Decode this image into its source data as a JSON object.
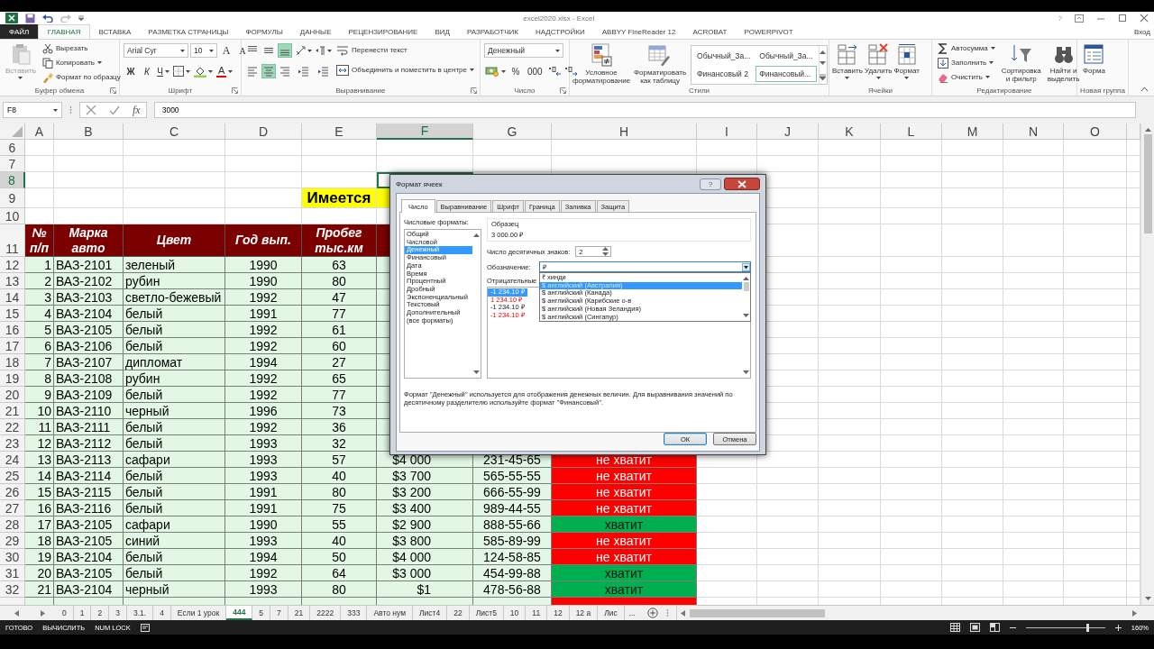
{
  "title_bar": {
    "title": "excel2020.xlsx - Excel",
    "help": "?"
  },
  "ribbon_tabs": [
    {
      "label": "ФАЙЛ",
      "kind": "file",
      "selected": false
    },
    {
      "label": "ГЛАВНАЯ",
      "kind": "tab",
      "selected": true
    },
    {
      "label": "ВСТАВКА",
      "kind": "tab",
      "selected": false
    },
    {
      "label": "РАЗМЕТКА СТРАНИЦЫ",
      "kind": "tab",
      "selected": false
    },
    {
      "label": "ФОРМУЛЫ",
      "kind": "tab",
      "selected": false
    },
    {
      "label": "ДАННЫЕ",
      "kind": "tab",
      "selected": false
    },
    {
      "label": "РЕЦЕНЗИРОВАНИЕ",
      "kind": "tab",
      "selected": false
    },
    {
      "label": "ВИД",
      "kind": "tab",
      "selected": false
    },
    {
      "label": "РАЗРАБОТЧИК",
      "kind": "tab",
      "selected": false
    },
    {
      "label": "НАДСТРОЙКИ",
      "kind": "tab",
      "selected": false
    },
    {
      "label": "ABBYY FineReader 12",
      "kind": "tab",
      "selected": false
    },
    {
      "label": "ACROBAT",
      "kind": "tab",
      "selected": false
    },
    {
      "label": "POWERPIVOT",
      "kind": "tab",
      "selected": false
    }
  ],
  "account": "Вход",
  "clipboard": {
    "caption": "Буфер обмена",
    "launcher": true,
    "paste": {
      "label": "Вставить",
      "disabled": true
    },
    "items": [
      {
        "kind": "cut",
        "label": "Вырезать"
      },
      {
        "kind": "copy",
        "label": "Копировать"
      },
      {
        "kind": "painter",
        "label": "Формат по образцу"
      }
    ]
  },
  "font": {
    "caption": "Шрифт",
    "launcher": true,
    "name": "Arial Cyr",
    "size": "10",
    "size_buttons": [
      {
        "kind": "grow",
        "label": "A"
      },
      {
        "kind": "shrink",
        "label": "A"
      }
    ],
    "styles": [
      {
        "kind": "bold",
        "label": "Ж"
      },
      {
        "kind": "italic",
        "label": "К"
      },
      {
        "kind": "underline",
        "label": "Ч"
      }
    ],
    "font_color": "A"
  },
  "alignment": {
    "caption": "Выравнивание",
    "launcher": true,
    "buttons": [
      {
        "kind": "top",
        "selected": false
      },
      {
        "kind": "middle",
        "selected": false
      },
      {
        "kind": "bottom",
        "selected": true
      },
      {
        "kind": "left",
        "selected": false
      },
      {
        "kind": "center",
        "selected": true
      },
      {
        "kind": "right",
        "selected": false
      }
    ],
    "wrap": "Перенести текст",
    "merge": "Объединить и поместить в центре"
  },
  "number": {
    "caption": "Число",
    "launcher": true,
    "format": "Денежный",
    "percent": "%",
    "thousands": "000"
  },
  "styles": {
    "caption": "Стили",
    "conditional": "Условное\nформатирование",
    "as_table": "Форматировать\nкак таблицу",
    "gallery": [
      {
        "label": "Обычный_За...",
        "selected": false
      },
      {
        "label": "Обычный_За...",
        "selected": false
      },
      {
        "label": "Финансовый 2",
        "selected": false
      },
      {
        "label": "Финансовый...",
        "selected": true
      }
    ]
  },
  "cells": {
    "caption": "Ячейки",
    "buttons": [
      {
        "kind": "insert",
        "label": "Вставить"
      },
      {
        "kind": "delete",
        "label": "Удалить"
      },
      {
        "kind": "format",
        "label": "Формат"
      }
    ]
  },
  "editing": {
    "caption": "Редактирование",
    "items": [
      {
        "kind": "autosum",
        "label": "Автосумма"
      },
      {
        "kind": "fill",
        "label": "Заполнить"
      },
      {
        "kind": "clear",
        "label": "Очистить"
      }
    ],
    "big": [
      {
        "kind": "sort",
        "label": "Сортировка\nи фильтр"
      },
      {
        "kind": "find",
        "label": "Найти и\nвыделить"
      }
    ]
  },
  "custom": {
    "caption": "Новая группа",
    "buttons": [
      {
        "kind": "form",
        "label": "Форма"
      }
    ]
  },
  "formula_bar": {
    "name_box": "F8",
    "fx": "fx",
    "formula": "3000"
  },
  "sheet": {
    "columns": [
      {
        "label": "A",
        "selected": false
      },
      {
        "label": "B",
        "selected": false
      },
      {
        "label": "C",
        "selected": false
      },
      {
        "label": "D",
        "selected": false
      },
      {
        "label": "E",
        "selected": false
      },
      {
        "label": "F",
        "selected": true
      },
      {
        "label": "G",
        "selected": false
      },
      {
        "label": "H",
        "selected": false
      },
      {
        "label": "I",
        "selected": false
      },
      {
        "label": "J",
        "selected": false
      },
      {
        "label": "K",
        "selected": false
      },
      {
        "label": "L",
        "selected": false
      },
      {
        "label": "M",
        "selected": false
      },
      {
        "label": "N",
        "selected": false
      },
      {
        "label": "O",
        "selected": false
      }
    ],
    "rows": [
      {
        "num": "6",
        "kind": "blank",
        "selected": false
      },
      {
        "num": "7",
        "kind": "blank",
        "selected": false
      },
      {
        "num": "8",
        "kind": "blank",
        "selected": true
      },
      {
        "num": "9",
        "kind": "note",
        "selected": false,
        "note": "Имеется"
      },
      {
        "num": "10",
        "kind": "blank",
        "selected": false
      },
      {
        "num": "11",
        "kind": "header",
        "selected": false,
        "headers": [
          "№ п/п",
          "Марка авто",
          "Цвет",
          "Год вып.",
          "Пробег тыс.км"
        ]
      },
      {
        "num": "12",
        "kind": "data",
        "selected": false,
        "cells": [
          "1",
          "ВАЗ-2101",
          "зеленый",
          "1990",
          "63"
        ]
      },
      {
        "num": "13",
        "kind": "data",
        "selected": false,
        "cells": [
          "2",
          "ВАЗ-2102",
          "рубин",
          "1990",
          "80"
        ]
      },
      {
        "num": "14",
        "kind": "data",
        "selected": false,
        "cells": [
          "3",
          "ВАЗ-2103",
          "светло-бежевый",
          "1992",
          "47"
        ]
      },
      {
        "num": "15",
        "kind": "data",
        "selected": false,
        "cells": [
          "4",
          "ВАЗ-2104",
          "белый",
          "1991",
          "77"
        ]
      },
      {
        "num": "16",
        "kind": "data",
        "selected": false,
        "cells": [
          "5",
          "ВАЗ-2105",
          "белый",
          "1992",
          "61"
        ]
      },
      {
        "num": "17",
        "kind": "data",
        "selected": false,
        "cells": [
          "6",
          "ВАЗ-2106",
          "белый",
          "1992",
          "60"
        ]
      },
      {
        "num": "18",
        "kind": "data",
        "selected": false,
        "cells": [
          "7",
          "ВАЗ-2107",
          "дипломат",
          "1994",
          "27"
        ]
      },
      {
        "num": "19",
        "kind": "data",
        "selected": false,
        "cells": [
          "8",
          "ВАЗ-2108",
          "рубин",
          "1992",
          "65"
        ]
      },
      {
        "num": "20",
        "kind": "data",
        "selected": false,
        "cells": [
          "9",
          "ВАЗ-2109",
          "белый",
          "1992",
          "77"
        ]
      },
      {
        "num": "21",
        "kind": "data",
        "selected": false,
        "cells": [
          "10",
          "ВАЗ-2110",
          "черный",
          "1996",
          "73"
        ]
      },
      {
        "num": "22",
        "kind": "data",
        "selected": false,
        "cells": [
          "11",
          "ВАЗ-2111",
          "белый",
          "1992",
          "36"
        ]
      },
      {
        "num": "23",
        "kind": "data",
        "selected": false,
        "cells": [
          "12",
          "ВАЗ-2112",
          "белый",
          "1993",
          "32"
        ]
      },
      {
        "num": "24",
        "kind": "data",
        "selected": false,
        "cells": [
          "13",
          "ВАЗ-2113",
          "сафари",
          "1993",
          "57",
          "$4 000",
          "231-45-65"
        ],
        "verdict": {
          "text": "не хватит",
          "enough": false
        }
      },
      {
        "num": "25",
        "kind": "data",
        "selected": false,
        "cells": [
          "14",
          "ВАЗ-2114",
          "белый",
          "1993",
          "40",
          "$3 700",
          "565-55-55"
        ],
        "verdict": {
          "text": "не хватит",
          "enough": false
        }
      },
      {
        "num": "26",
        "kind": "data",
        "selected": false,
        "cells": [
          "15",
          "ВАЗ-2115",
          "белый",
          "1991",
          "80",
          "$3 200",
          "666-55-99"
        ],
        "verdict": {
          "text": "не хватит",
          "enough": false
        }
      },
      {
        "num": "27",
        "kind": "data",
        "selected": false,
        "cells": [
          "16",
          "ВАЗ-2116",
          "белый",
          "1991",
          "75",
          "$3 400",
          "989-44-55"
        ],
        "verdict": {
          "text": "не хватит",
          "enough": false
        }
      },
      {
        "num": "28",
        "kind": "data",
        "selected": false,
        "cells": [
          "17",
          "ВАЗ-2105",
          "сафари",
          "1990",
          "55",
          "$2 900",
          "888-55-66"
        ],
        "verdict": {
          "text": "хватит",
          "enough": true
        }
      },
      {
        "num": "29",
        "kind": "data",
        "selected": false,
        "cells": [
          "18",
          "ВАЗ-2105",
          "синий",
          "1993",
          "40",
          "$3 800",
          "585-89-99"
        ],
        "verdict": {
          "text": "не хватит",
          "enough": false
        }
      },
      {
        "num": "30",
        "kind": "data",
        "selected": false,
        "cells": [
          "19",
          "ВАЗ-2104",
          "белый",
          "1994",
          "50",
          "$4 000",
          "124-58-85"
        ],
        "verdict": {
          "text": "не хватит",
          "enough": false
        }
      },
      {
        "num": "31",
        "kind": "data",
        "selected": false,
        "cells": [
          "20",
          "ВАЗ-2105",
          "белый",
          "1992",
          "64",
          "$3 000",
          "454-99-88"
        ],
        "verdict": {
          "text": "хватит",
          "enough": true
        }
      },
      {
        "num": "32",
        "kind": "data",
        "selected": false,
        "cells": [
          "21",
          "ВАЗ-2104",
          "черный",
          "1993",
          "80",
          "$1",
          "478-56-88"
        ],
        "verdict": {
          "text": "хватит",
          "enough": true
        }
      },
      {
        "kind": "partial",
        "selected": false,
        "verdict": {
          "enough": false
        }
      }
    ]
  },
  "dialog": {
    "title": "Формат ячеек",
    "help": "?",
    "tabs": [
      {
        "label": "Число",
        "selected": true
      },
      {
        "label": "Выравнивание",
        "selected": false
      },
      {
        "label": "Шрифт",
        "selected": false
      },
      {
        "label": "Граница",
        "selected": false
      },
      {
        "label": "Заливка",
        "selected": false
      },
      {
        "label": "Защита",
        "selected": false
      }
    ],
    "formats_label": "Числовые форматы:",
    "formats": [
      {
        "label": "Общий",
        "selected": false
      },
      {
        "label": "Числовой",
        "selected": false
      },
      {
        "label": "Денежный",
        "selected": true
      },
      {
        "label": "Финансовый",
        "selected": false
      },
      {
        "label": "Дата",
        "selected": false
      },
      {
        "label": "Время",
        "selected": false
      },
      {
        "label": "Процентный",
        "selected": false
      },
      {
        "label": "Дробный",
        "selected": false
      },
      {
        "label": "Экспоненциальный",
        "selected": false
      },
      {
        "label": "Текстовый",
        "selected": false
      },
      {
        "label": "Дополнительный",
        "selected": false
      },
      {
        "label": "(все форматы)",
        "selected": false
      }
    ],
    "sample_label": "Образец",
    "sample": "3 000.00 ₽",
    "decimals_label": "Число десятичных знаков:",
    "decimals": "2",
    "symbol_label": "Обозначение:",
    "symbol": "₽",
    "symbol_options": [
      {
        "label": "₹ хинди",
        "selected": false
      },
      {
        "label": "$ английский (Австралия)",
        "selected": true
      },
      {
        "label": "$ английский (Канада)",
        "selected": false
      },
      {
        "label": "$ английский (Карибские о-в",
        "selected": false
      },
      {
        "label": "$ английский (Новая Зеландия)",
        "selected": false
      },
      {
        "label": "$ английский (Сингапур)",
        "selected": false
      }
    ],
    "negative_label": "Отрицательные",
    "negatives": [
      {
        "label": "-1 234.10 ₽",
        "red": false,
        "selected": true
      },
      {
        "label": "1 234.10 ₽",
        "red": true,
        "selected": false
      },
      {
        "label": "-1 234.10 ₽",
        "red": false,
        "selected": false
      },
      {
        "label": "-1 234.10 ₽",
        "red": true,
        "selected": false
      }
    ],
    "description": "Формат ''Денежный'' используется для отображения денежных величин. Для выравнивания значений по десятичному разделителю используйте формат ''Финансовый''.",
    "buttons": [
      {
        "label": "ОК",
        "kind": "default"
      },
      {
        "label": "Отмена",
        "kind": "normal"
      }
    ]
  },
  "sheet_tabs": {
    "tabs": [
      {
        "label": "0",
        "selected": false
      },
      {
        "label": "1",
        "selected": false
      },
      {
        "label": "2",
        "selected": false
      },
      {
        "label": "3",
        "selected": false
      },
      {
        "label": "3.1.",
        "selected": false
      },
      {
        "label": "4",
        "selected": false
      },
      {
        "label": "Если 1 урок",
        "selected": false
      },
      {
        "label": "444",
        "selected": true
      },
      {
        "label": "5",
        "selected": false
      },
      {
        "label": "7",
        "selected": false
      },
      {
        "label": "21",
        "selected": false
      },
      {
        "label": "2222",
        "selected": false
      },
      {
        "label": "333",
        "selected": false
      },
      {
        "label": "Авто нум",
        "selected": false
      },
      {
        "label": "Лист4",
        "selected": false
      },
      {
        "label": "22",
        "selected": false
      },
      {
        "label": "Лист5",
        "selected": false
      },
      {
        "label": "10",
        "selected": false
      },
      {
        "label": "11",
        "selected": false
      },
      {
        "label": "12",
        "selected": false
      },
      {
        "label": "12 а",
        "selected": false
      },
      {
        "label": "Лис",
        "selected": false
      }
    ],
    "more": "..."
  },
  "status_bar": {
    "items": [
      "ГОТОВО",
      "ВЫЧИСЛИТЬ",
      "NUM LOCK"
    ],
    "zoom": "160%",
    "level": 0.78
  }
}
